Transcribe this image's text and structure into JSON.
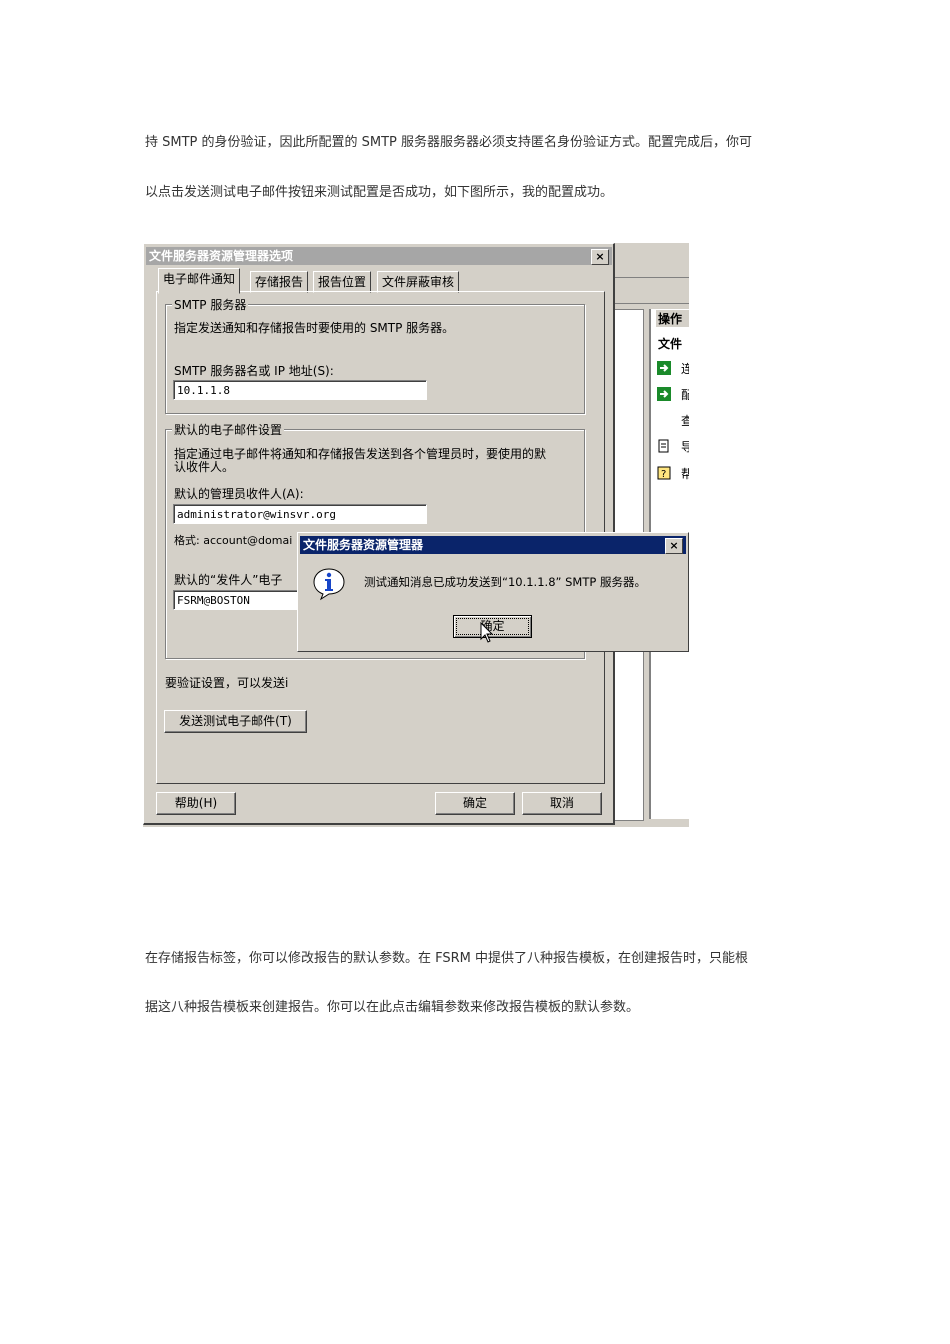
{
  "doc": {
    "para1_line1": "持 SMTP 的身份验证，因此所配置的 SMTP 服务器服务器必须支持匿名身份验证方式。配置完成后，你可",
    "para1_line2": "以点击发送测试电子邮件按钮来测试配置是否成功，如下图所示，我的配置成功。",
    "para2_line1": "在存储报告标签，你可以修改报告的默认参数。在 FSRM 中提供了八种报告模板，在创建报告时，只能根",
    "para2_line2": "据这八种报告模板来创建报告。你可以在此点击编辑参数来修改报告模板的默认参数。"
  },
  "options_dialog": {
    "title": "文件服务器资源管理器选项",
    "close": "×",
    "tabs": [
      "电子邮件通知",
      "存储报告",
      "报告位置",
      "文件屏蔽审核"
    ],
    "smtp_group": "SMTP 服务器",
    "smtp_desc": "指定发送通知和存储报告时要使用的 SMTP 服务器。",
    "smtp_label": "SMTP 服务器名或 IP 地址(S):",
    "smtp_value": "10.1.1.8",
    "email_group": "默认的电子邮件设置",
    "email_desc_1": "指定通过电子邮件将通知和存储报告发送到各个管理员时，要使用的默",
    "email_desc_2": "认收件人。",
    "admin_label": "默认的管理员收件人(A):",
    "admin_value": "administrator@winsvr.org",
    "format_text": "格式: account@domai",
    "from_label": "默认的“发件人”电子",
    "from_value": "FSRM@BOSTON",
    "verify_text": "要验证设置，可以发送i",
    "send_test_button": "发送测试电子邮件(T)",
    "help_button": "帮助(H)",
    "ok_button": "确定",
    "cancel_button": "取消"
  },
  "message_box": {
    "title": "文件服务器资源管理器",
    "close": "×",
    "text": "测试通知消息已成功发送到“10.1.1.8” SMTP 服务器。",
    "ok_button": "确定"
  },
  "background_window": {
    "actions_header": "操作",
    "file_header": "文件",
    "item_glyphs": [
      "连",
      "配",
      "查",
      "导",
      "帮"
    ]
  },
  "colors": {
    "dialog_face": "#d4d0c8",
    "active_title": "#0a246a",
    "inactive_title": "#a6a6a6"
  }
}
